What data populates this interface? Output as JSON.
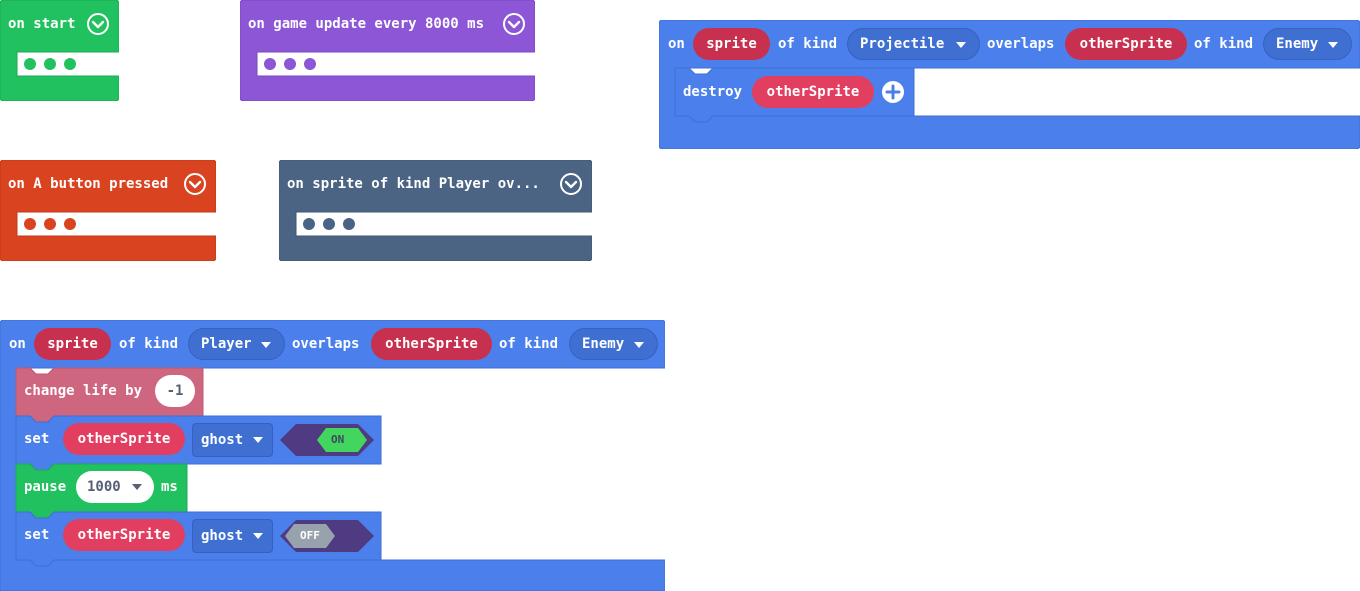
{
  "colors": {
    "events_green": "#22c15f",
    "game_purple": "#8c56d6",
    "controller_orange": "#d9431f",
    "sprites_slate": "#4b6483",
    "sprites_blue": "#4b80ec",
    "info_pink": "#cf6680",
    "variable_red": "#e23e60",
    "toggle_purple": "#4f3b82",
    "toggle_on": "#43d65f",
    "toggle_off": "#98a2ad"
  },
  "blocks": {
    "on_start": {
      "label": "on start",
      "collapse_icon": "chevron-down-icon"
    },
    "game_update": {
      "label": "on game update every 8000 ms",
      "collapse_icon": "chevron-down-icon"
    },
    "a_button": {
      "label": "on A button pressed",
      "collapse_icon": "chevron-down-icon"
    },
    "collapsed_overlap": {
      "label": "on sprite of kind Player ov...",
      "collapse_icon": "chevron-down-icon"
    },
    "projectile_overlap": {
      "on": "on",
      "sprite": "sprite",
      "of_kind_1": "of kind",
      "kind_1": "Projectile",
      "overlaps": "overlaps",
      "other_sprite": "otherSprite",
      "of_kind_2": "of kind",
      "kind_2": "Enemy",
      "destroy": "destroy",
      "destroy_target": "otherSprite",
      "add_icon": "plus-circle-icon"
    },
    "player_overlap": {
      "on": "on",
      "sprite": "sprite",
      "of_kind_1": "of kind",
      "kind_1": "Player",
      "overlaps": "overlaps",
      "other_sprite": "otherSprite",
      "of_kind_2": "of kind",
      "kind_2": "Enemy",
      "change_life": "change life by",
      "change_life_value": "-1",
      "set_1": "set",
      "set_1_target": "otherSprite",
      "set_1_flag": "ghost",
      "set_1_toggle": "ON",
      "pause": "pause",
      "pause_value": "1000",
      "pause_unit": "ms",
      "set_2": "set",
      "set_2_target": "otherSprite",
      "set_2_flag": "ghost",
      "set_2_toggle": "OFF"
    }
  }
}
